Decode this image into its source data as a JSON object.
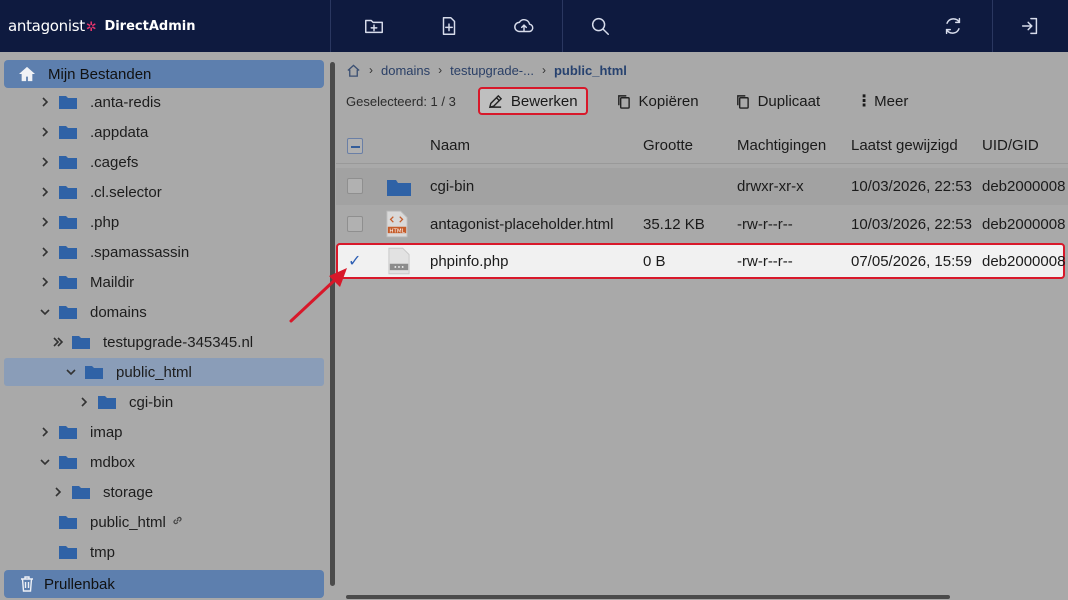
{
  "brand": {
    "logo": "antagonist",
    "product": "DirectAdmin"
  },
  "topbar": {
    "icons": [
      "new-folder-icon",
      "new-file-icon",
      "upload-icon",
      "search-icon",
      "refresh-icon",
      "logout-icon"
    ]
  },
  "sidebar": {
    "header": "Mijn Bestanden",
    "footer": "Prullenbak",
    "items": [
      {
        "label": ".anta-redis",
        "state": "collapsed",
        "depth": 0
      },
      {
        "label": ".appdata",
        "state": "collapsed",
        "depth": 0
      },
      {
        "label": ".cagefs",
        "state": "collapsed",
        "depth": 0
      },
      {
        "label": ".cl.selector",
        "state": "collapsed",
        "depth": 0
      },
      {
        "label": ".php",
        "state": "collapsed",
        "depth": 0
      },
      {
        "label": ".spamassassin",
        "state": "collapsed",
        "depth": 0
      },
      {
        "label": "Maildir",
        "state": "collapsed",
        "depth": 0
      },
      {
        "label": "domains",
        "state": "expanded",
        "depth": 0
      },
      {
        "label": "testupgrade-345345.nl",
        "state": "double",
        "depth": 1
      },
      {
        "label": "public_html",
        "state": "expanded",
        "depth": 2,
        "selected": true
      },
      {
        "label": "cgi-bin",
        "state": "collapsed",
        "depth": 3
      },
      {
        "label": "imap",
        "state": "collapsed",
        "depth": 0
      },
      {
        "label": "mdbox",
        "state": "expanded",
        "depth": 0
      },
      {
        "label": "storage",
        "state": "collapsed",
        "depth": 1
      },
      {
        "label": "public_html",
        "state": "link",
        "depth": 0
      },
      {
        "label": "tmp",
        "state": "none",
        "depth": 0
      }
    ]
  },
  "breadcrumb": {
    "items": [
      "domains",
      "testupgrade-...",
      "public_html"
    ]
  },
  "toolbar": {
    "selected": "Geselecteerd: 1 / 3",
    "edit": "Bewerken",
    "copy": "Kopiëren",
    "duplicate": "Duplicaat",
    "more": "Meer"
  },
  "table": {
    "headers": {
      "name": "Naam",
      "size": "Grootte",
      "perms": "Machtigingen",
      "modified": "Laatst gewijzigd",
      "uid": "UID/GID"
    },
    "rows": [
      {
        "name": "cgi-bin",
        "size": "",
        "perms": "drwxr-xr-x",
        "modified": "10/03/2026, 22:53",
        "uid": "deb2000008",
        "icon": "folder-icon"
      },
      {
        "name": "antagonist-placeholder.html",
        "size": "35.12 KB",
        "perms": "-rw-r--r--",
        "modified": "10/03/2026, 22:53",
        "uid": "deb2000008",
        "icon": "html-file-icon",
        "icon_label": "HTML"
      },
      {
        "name": "phpinfo.php",
        "size": "0 B",
        "perms": "-rw-r--r--",
        "modified": "07/05/2026, 15:59",
        "uid": "deb2000008",
        "icon": "php-file-icon",
        "selected": true
      }
    ]
  },
  "colors": {
    "topbar": "#0e1a3f",
    "accent": "#5d7fae",
    "highlight": "#d8182a",
    "folder": "#2f62a6"
  }
}
